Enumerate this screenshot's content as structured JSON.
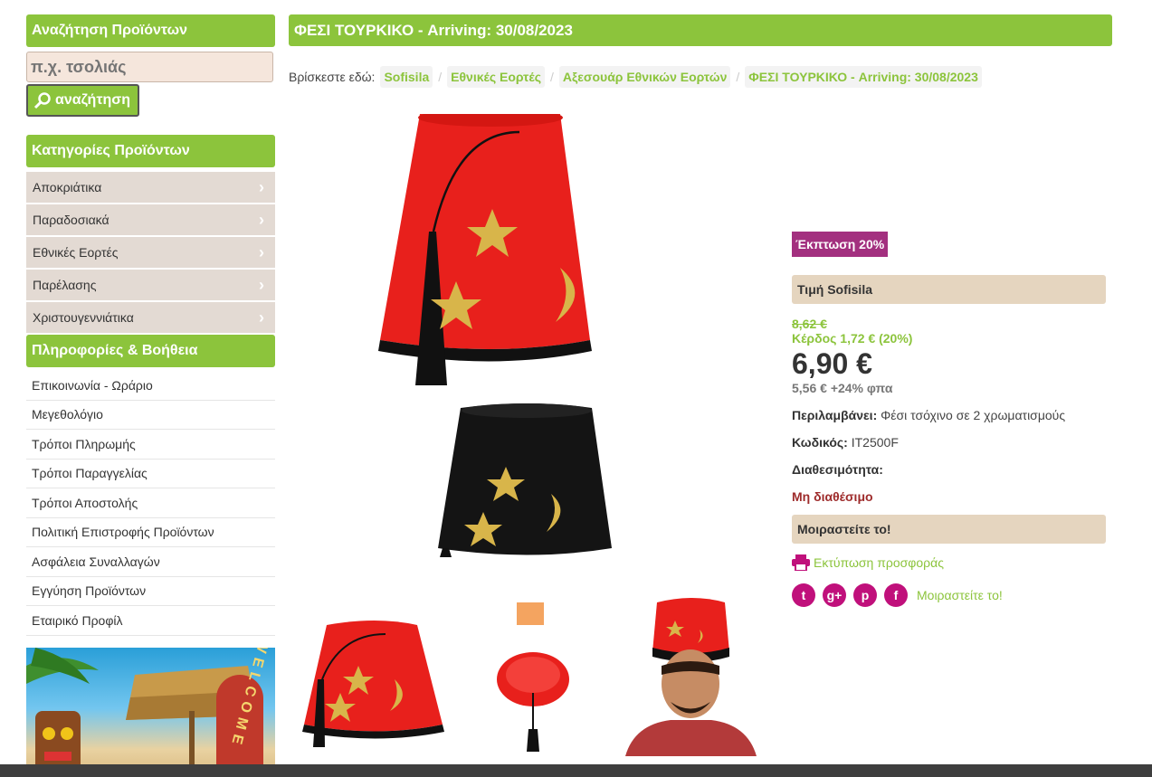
{
  "search": {
    "header": "Αναζήτηση Προϊόντων",
    "placeholder": "π.χ. τσολιάς",
    "button_label": "αναζήτηση"
  },
  "categories": {
    "header": "Κατηγορίες Προϊόντων",
    "items": [
      "Αποκριάτικα",
      "Παραδοσιακά",
      "Εθνικές Εορτές",
      "Παρέλασης",
      "Χριστουγεννιάτικα"
    ]
  },
  "info": {
    "header": "Πληροφορίες & Βοήθεια",
    "items": [
      "Επικοινωνία - Ωράριο",
      "Μεγεθολόγιο",
      "Τρόποι Πληρωμής",
      "Τρόποι Παραγγελίας",
      "Τρόποι Αποστολής",
      "Πολιτική Επιστροφής Προϊόντων",
      "Ασφάλεια Συναλλαγών",
      "Εγγύηση Προϊόντων",
      "Εταιρικό Προφίλ"
    ]
  },
  "banner": {
    "text": "WELCOME"
  },
  "product": {
    "title": "ΦΕΣΙ ΤΟΥΡΚΙΚΟ - Arriving: 30/08/2023",
    "breadcrumb_prefix": "Βρίσκεστε εδώ:",
    "breadcrumb": [
      "Sofisila",
      "Εθνικές Εορτές",
      "Αξεσουάρ Εθνικών Εορτών",
      "ΦΕΣΙ ΤΟΥΡΚΙΚΟ - Arriving: 30/08/2023"
    ],
    "discount": "Έκπτωση 20%",
    "price_label": "Τιμή Sofisila",
    "old_price": "8,62 €",
    "profit": "Κέρδος 1,72 € (20%)",
    "price": "6,90 €",
    "vat": "5,56 € +24% φπα",
    "includes_label": "Περιλαμβάνει:",
    "includes_value": "Φέσι τσόχινο σε 2 χρωματισμούς",
    "code_label": "Κωδικός:",
    "code_value": "IT2500F",
    "availability_label": "Διαθεσιμότητα:",
    "availability_value": "Μη διαθέσιμο",
    "share_label": "Μοιραστείτε το!",
    "print_label": "Εκτύπωση προσφοράς",
    "share_text": "Μοιραστείτε το!",
    "social_icons": [
      "twitter-icon",
      "google-plus-icon",
      "pinterest-icon",
      "facebook-icon"
    ]
  },
  "colors": {
    "accent_green": "#8cc43c",
    "discount_purple": "#a3307f",
    "beige": "#e5d5bf",
    "social_pink": "#c0107b",
    "unavailable_red": "#9e2b2b"
  }
}
